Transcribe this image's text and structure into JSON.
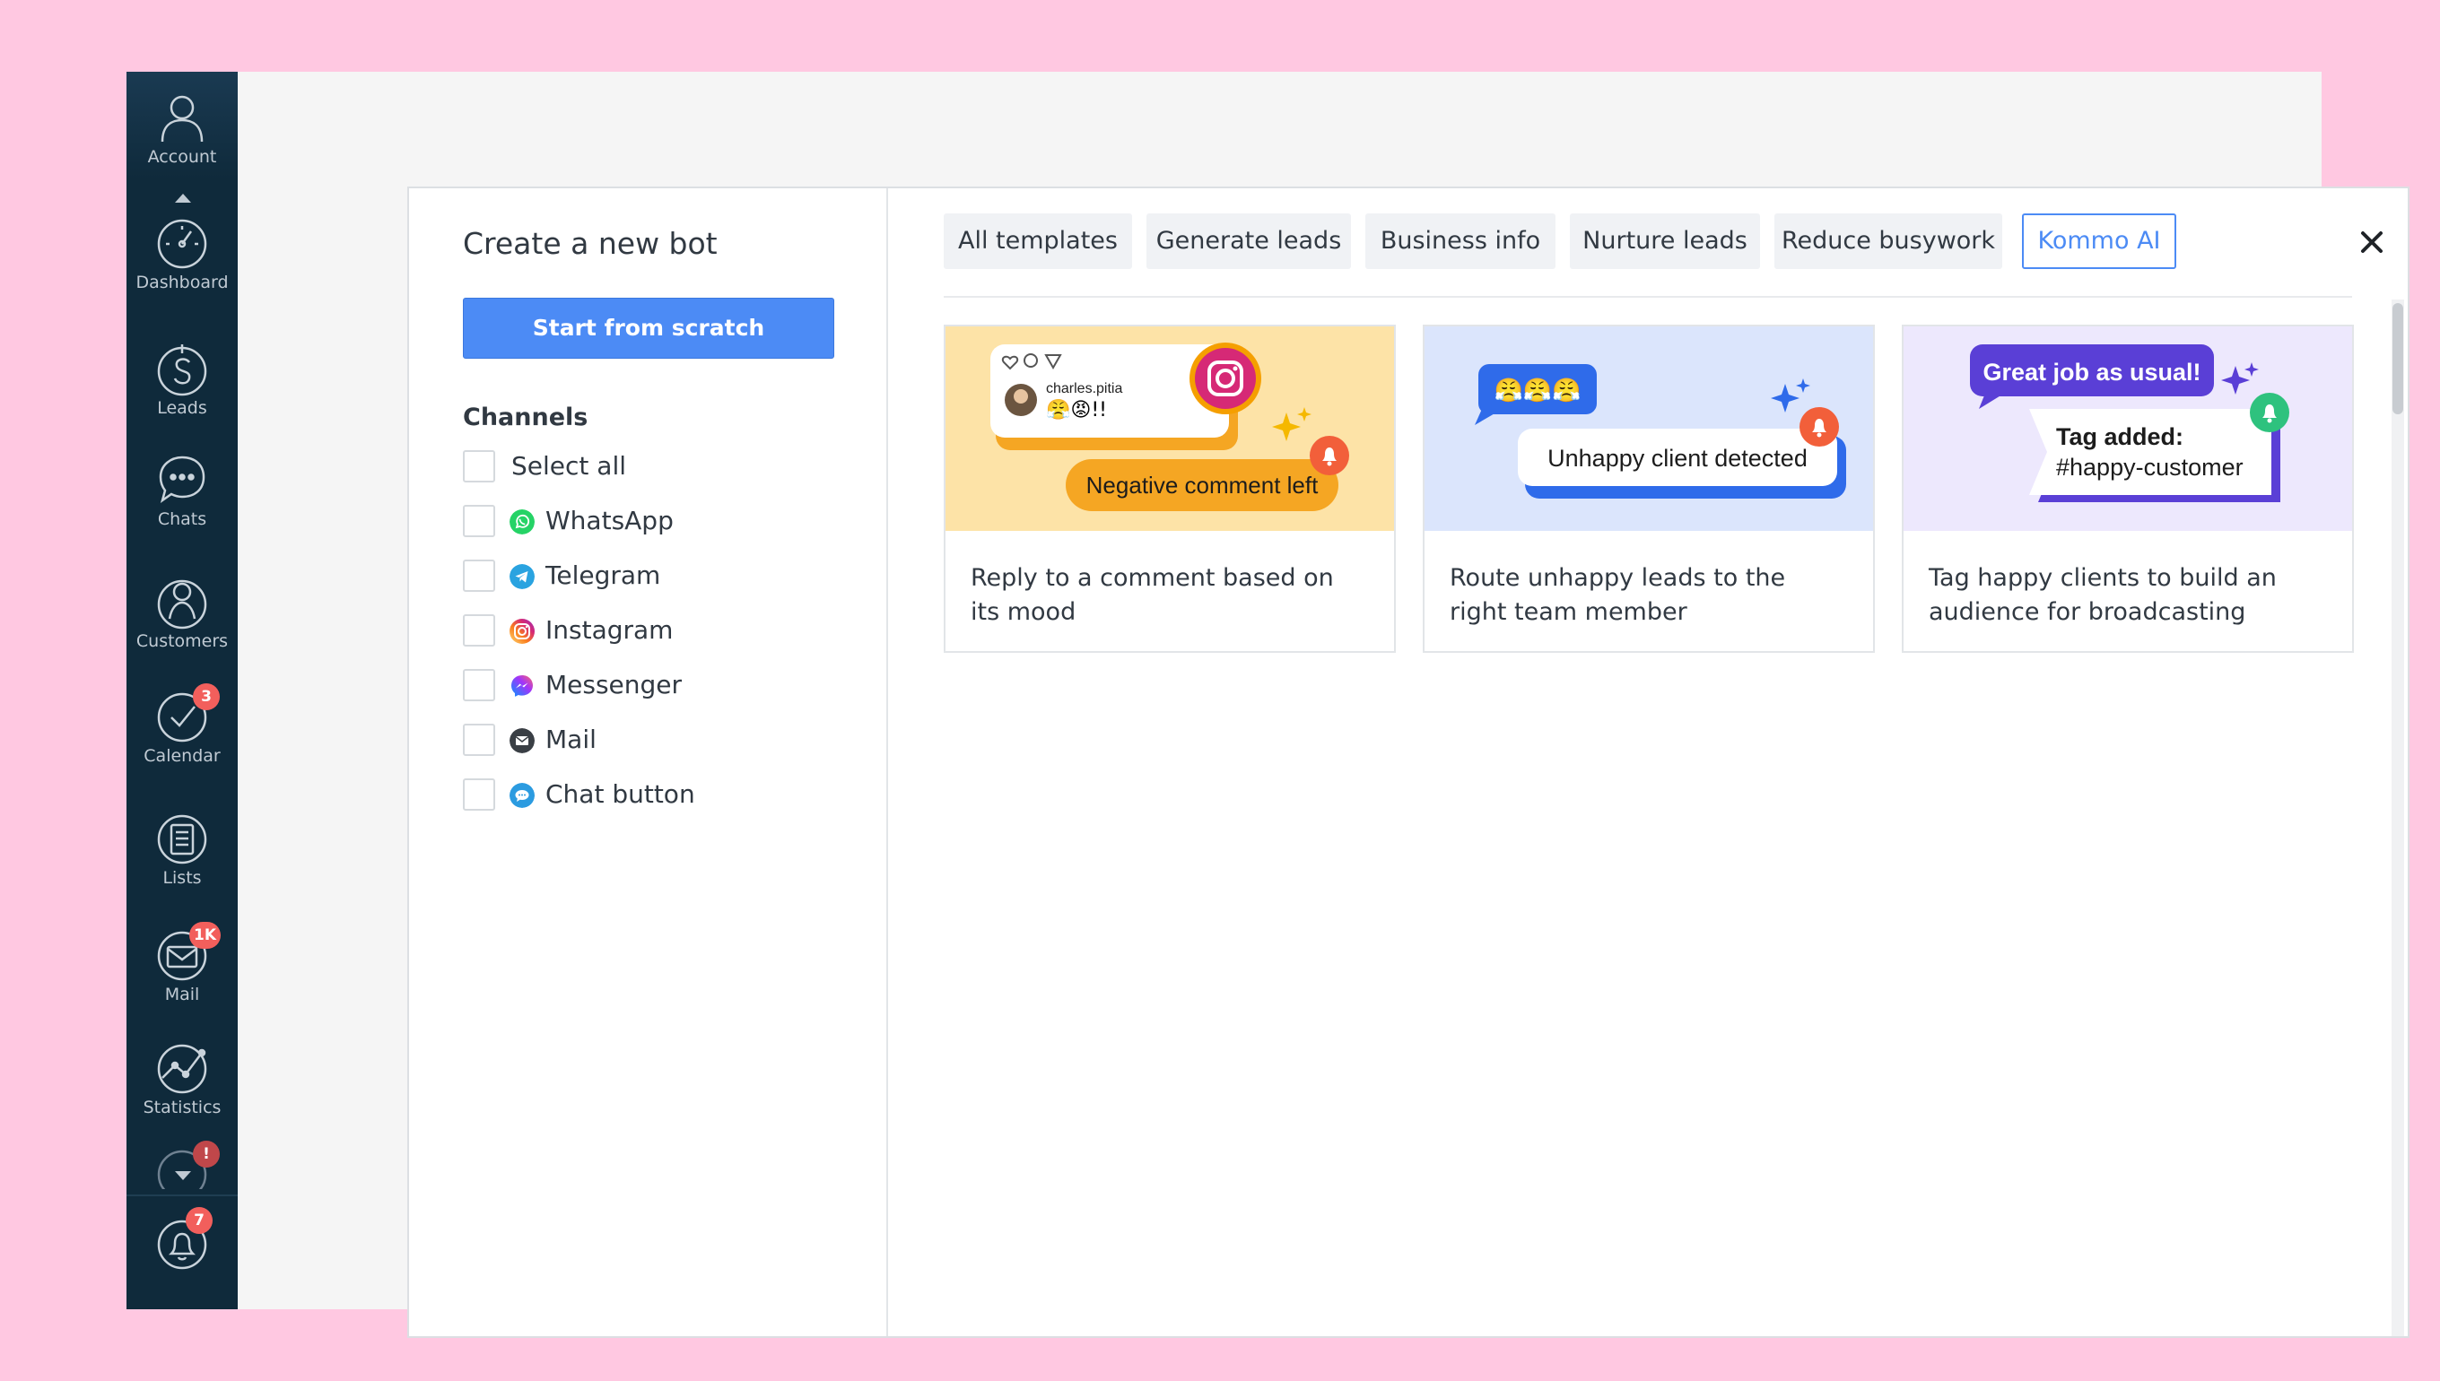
{
  "sidebar": {
    "items": [
      {
        "label": "Account"
      },
      {
        "label": "Dashboard"
      },
      {
        "label": "Leads"
      },
      {
        "label": "Chats"
      },
      {
        "label": "Customers"
      },
      {
        "label": "Calendar",
        "badge": "3"
      },
      {
        "label": "Lists"
      },
      {
        "label": "Mail",
        "badge": "1K"
      },
      {
        "label": "Statistics"
      },
      {
        "label": "",
        "badge": "!"
      },
      {
        "label": "",
        "badge": "7"
      }
    ]
  },
  "modal": {
    "title": "Create a new bot",
    "scratch_button": "Start from scratch",
    "channels_title": "Channels",
    "channels": [
      {
        "label": "Select all",
        "icon": "none"
      },
      {
        "label": "WhatsApp",
        "icon": "whatsapp-icon",
        "color": "#25d366"
      },
      {
        "label": "Telegram",
        "icon": "telegram-icon",
        "color": "#2aa3e0"
      },
      {
        "label": "Instagram",
        "icon": "instagram-icon",
        "color": "#e1306c"
      },
      {
        "label": "Messenger",
        "icon": "messenger-icon",
        "color": "#a334fa"
      },
      {
        "label": "Mail",
        "icon": "mail-icon",
        "color": "#3a3f45"
      },
      {
        "label": "Chat button",
        "icon": "chat-button-icon",
        "color": "#2b9be0"
      }
    ],
    "tabs": [
      {
        "label": "All templates",
        "active": false
      },
      {
        "label": "Generate leads",
        "active": false
      },
      {
        "label": "Business info",
        "active": false
      },
      {
        "label": "Nurture leads",
        "active": false
      },
      {
        "label": "Reduce busywork",
        "active": false
      },
      {
        "label": "Kommo AI",
        "active": true
      }
    ],
    "cards": [
      {
        "text": "Reply to a comment based on its mood",
        "bubble": "Negative comment left",
        "username": "charles.pitia",
        "emojis": "😤😡!!"
      },
      {
        "text": "Route unhappy leads to the right team member",
        "bubble": "Unhappy client detected",
        "emojis": "😤😤😤"
      },
      {
        "text": "Tag happy clients to build an audience for broadcasting",
        "bubble": "Great job as usual!",
        "tag_line1": "Tag added:",
        "tag_line2": "#happy-customer"
      }
    ]
  },
  "colors": {
    "background": "#ffc8e1",
    "sidebar": "#0f2a3b",
    "accent": "#4c8bf5",
    "badge": "#f25f5c"
  }
}
